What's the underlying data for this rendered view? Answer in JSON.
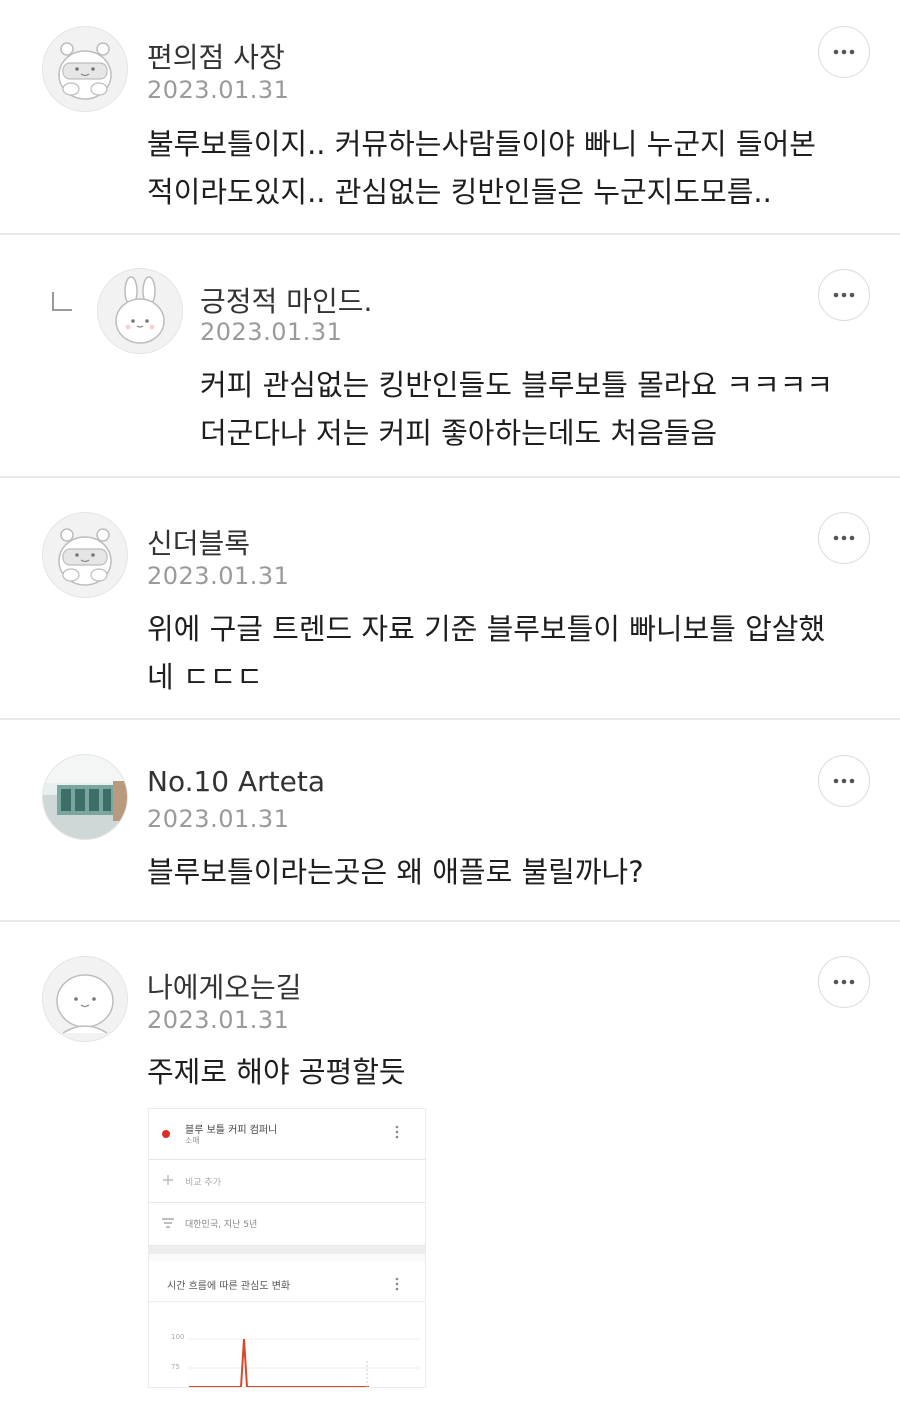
{
  "comments": [
    {
      "author": "편의점 사장",
      "date": "2023.01.31",
      "lines": [
        "불루보틀이지.. 커뮤하는사람들이야 빠니 누군지 들어본",
        "적이라도있지.. 관심없는 킹반인들은 누군지도모름.."
      ],
      "avatar": "hamster-avatar-icon",
      "is_reply": false
    },
    {
      "author": "긍정적 마인드.",
      "date": "2023.01.31",
      "lines": [
        "커피 관심없는 킹반인들도 블루보틀 몰라요 ㅋㅋㅋㅋ",
        "더군다나 저는 커피 좋아하는데도 처음들음"
      ],
      "avatar": "rabbit-avatar-icon",
      "is_reply": true
    },
    {
      "author": "신더블록",
      "date": "2023.01.31",
      "lines": [
        "위에 구글 트렌드 자료 기준 블루보틀이 빠니보틀 압살했",
        "네 ㄷㄷㄷ"
      ],
      "avatar": "hamster-avatar-icon",
      "is_reply": false
    },
    {
      "author": "No.10 Arteta",
      "date": "2023.01.31",
      "lines": [
        "블루보틀이라는곳은 왜 애플로 불릴까나?"
      ],
      "avatar": "photo-avatar",
      "is_reply": false
    },
    {
      "author": "나에게오는길",
      "date": "2023.01.31",
      "lines": [
        "주제로 해야 공평할듯"
      ],
      "avatar": "face-avatar-icon",
      "is_reply": false
    }
  ],
  "embed": {
    "topic_title": "블루 보틀 커피 컴퍼니",
    "topic_subtitle": "소매",
    "add_compare": "비교 추가",
    "filter": "대한민국, 지난 5년",
    "section_title": "시간 흐름에 따른 관심도 변화",
    "axis_100": "100",
    "axis_75": "75",
    "line_color": "#d9482b",
    "dot_color": "#d93025"
  },
  "colors": {
    "divider": "#e8e8e8",
    "date": "#9a9a9a",
    "name": "#333333"
  }
}
